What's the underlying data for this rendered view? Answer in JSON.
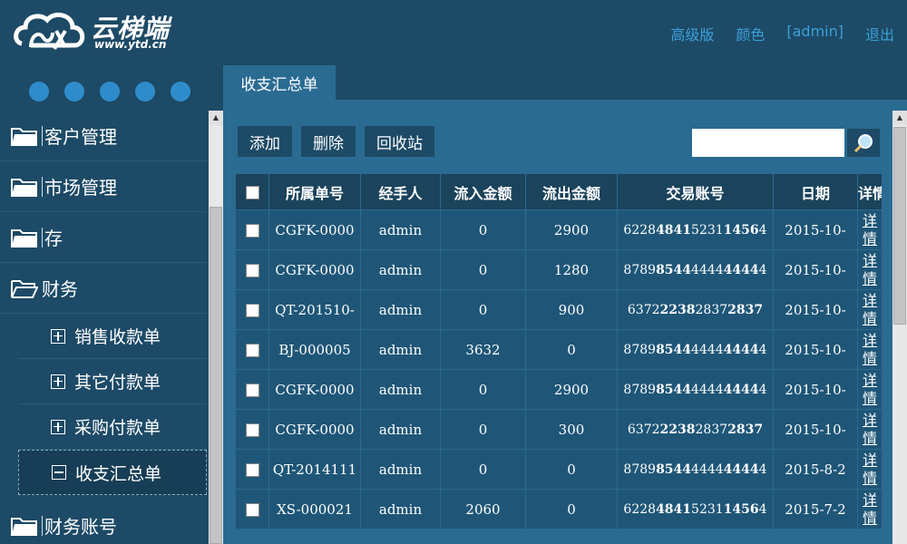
{
  "header": {
    "logo_text": "云梯端",
    "logo_url": "www.ytd.cn",
    "links": [
      "高级版",
      "颜色",
      "[admin]",
      "退出"
    ]
  },
  "sidebar": {
    "menu": [
      {
        "label": "客户管理"
      },
      {
        "label": "市场管理"
      },
      {
        "label": "存"
      },
      {
        "label": "财务"
      }
    ],
    "submenu": [
      {
        "label": "销售收款单",
        "state": "collapsed"
      },
      {
        "label": "其它付款单",
        "state": "collapsed"
      },
      {
        "label": "采购付款单",
        "state": "collapsed"
      },
      {
        "label": "收支汇总单",
        "state": "expanded"
      }
    ],
    "last_item": {
      "label": "财务账号"
    }
  },
  "tab": {
    "label": "收支汇总单"
  },
  "toolbar": {
    "add": "添加",
    "delete": "删除",
    "recycle": "回收站"
  },
  "search": {
    "value": ""
  },
  "table": {
    "headers": [
      "所属单号",
      "经手人",
      "流入金额",
      "流出金额",
      "交易账号",
      "日期",
      "详情"
    ],
    "detail_label": "详情",
    "rows": [
      {
        "order": "CGFK-0000",
        "handler": "admin",
        "in": "0",
        "out": "2900",
        "account": "6228484152311456",
        "account_html": "6228<b>4841</b>5231<b>1456</b>4",
        "date": "2015-10-"
      },
      {
        "order": "CGFK-0000",
        "handler": "admin",
        "in": "0",
        "out": "1280",
        "account": "8789854444444444",
        "account_html": "8789<b>8544</b>4444<b>4444</b>4",
        "date": "2015-10-"
      },
      {
        "order": "QT-201510-",
        "handler": "admin",
        "in": "0",
        "out": "900",
        "account": "637222382837283",
        "account_html": "6372<b>2238</b>2837<b>2837</b>",
        "date": "2015-10-"
      },
      {
        "order": "BJ-000005",
        "handler": "admin",
        "in": "3632",
        "out": "0",
        "account": "8789854444444444",
        "account_html": "8789<b>8544</b>4444<b>4444</b>4",
        "date": "2015-10-"
      },
      {
        "order": "CGFK-0000",
        "handler": "admin",
        "in": "0",
        "out": "2900",
        "account": "8789854444444444",
        "account_html": "8789<b>8544</b>4444<b>4444</b>4",
        "date": "2015-10-"
      },
      {
        "order": "CGFK-0000",
        "handler": "admin",
        "in": "0",
        "out": "300",
        "account": "637222382837283",
        "account_html": "6372<b>2238</b>2837<b>2837</b>",
        "date": "2015-10-"
      },
      {
        "order": "QT-2014111",
        "handler": "admin",
        "in": "0",
        "out": "0",
        "account": "8789854444444444",
        "account_html": "8789<b>8544</b>4444<b>4444</b>4",
        "date": "2015-8-2"
      },
      {
        "order": "XS-000021",
        "handler": "admin",
        "in": "2060",
        "out": "0",
        "account": "6228484152311456",
        "account_html": "6228<b>4841</b>5231<b>1456</b>4",
        "date": "2015-7-2"
      }
    ]
  },
  "colors": {
    "bg": "#1d4a66",
    "panel": "#2a6b92",
    "link": "#3d9fd8"
  }
}
